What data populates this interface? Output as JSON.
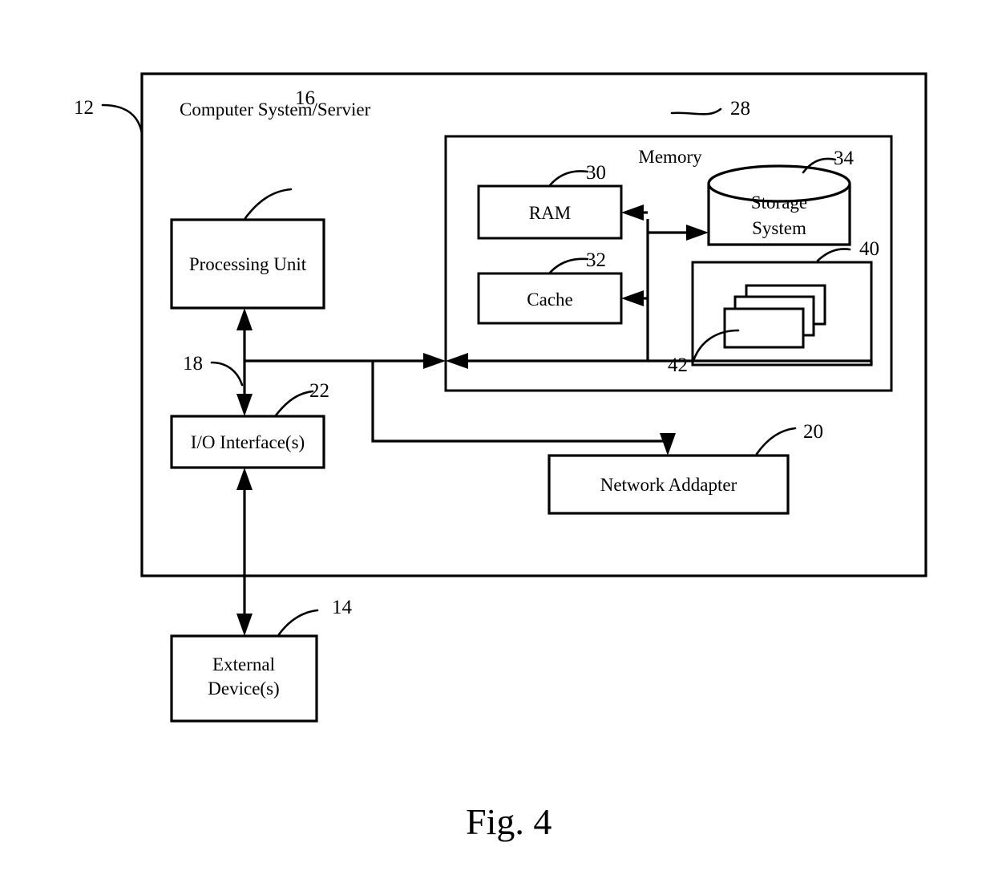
{
  "figure": {
    "caption": "Fig. 4",
    "outer_title": "Computer System/Servier",
    "outer_ref": "12"
  },
  "blocks": {
    "processing_unit": {
      "label": "Processing Unit",
      "ref": "16"
    },
    "io_interface": {
      "label": "I/O Interface(s)",
      "ref": "22"
    },
    "external_device": {
      "label_line1": "External",
      "label_line2": "Device(s)",
      "ref": "14"
    },
    "network_adapter": {
      "label": "Network Addapter",
      "ref": "20"
    },
    "memory": {
      "label": "Memory",
      "ref": "28"
    },
    "ram": {
      "label": "RAM",
      "ref": "30"
    },
    "cache": {
      "label": "Cache",
      "ref": "32"
    },
    "storage_system": {
      "label_line1": "Storage",
      "label_line2": "System",
      "ref": "34"
    },
    "program_container": {
      "ref": "40"
    },
    "program_modules": {
      "ref": "42"
    },
    "bus": {
      "ref": "18"
    }
  },
  "colors": {
    "stroke": "#000000",
    "background": "#ffffff"
  }
}
